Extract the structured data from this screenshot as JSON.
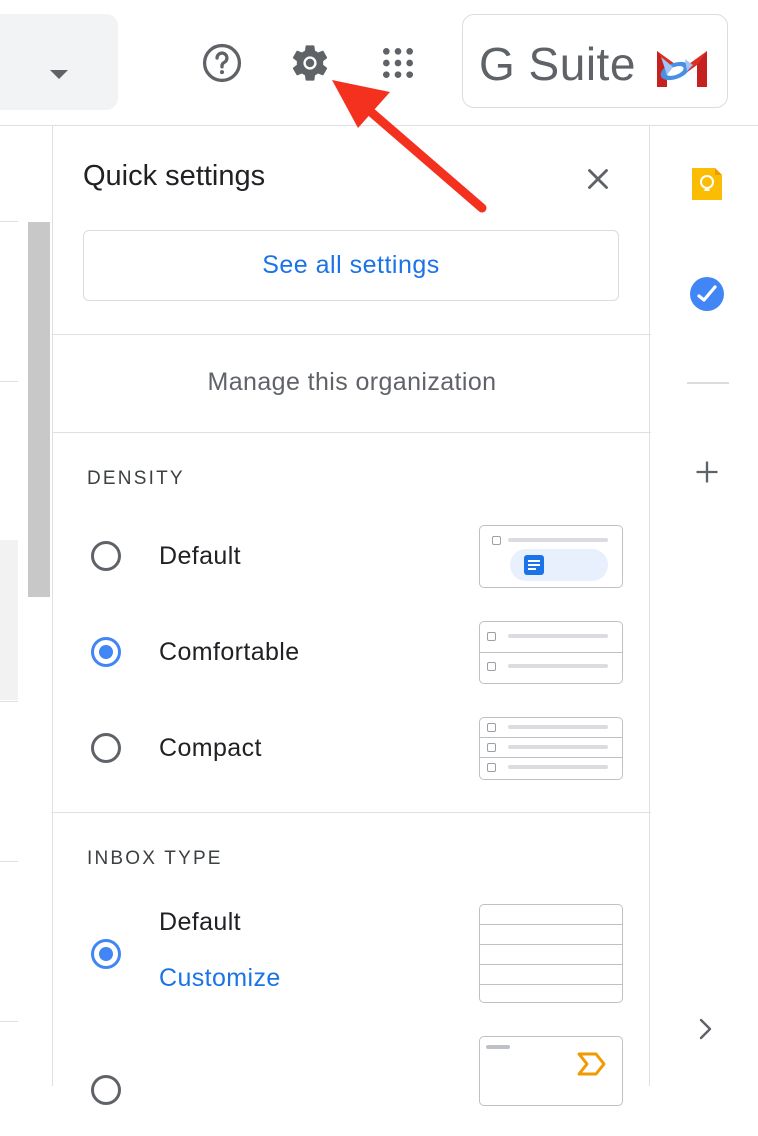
{
  "header": {
    "help_icon": "help-circle-icon",
    "settings_icon": "gear-icon",
    "apps_icon": "apps-grid-icon",
    "brand_text": "G Suite",
    "colors": {
      "icon": "#5f6368",
      "brand_text": "#5f6368"
    }
  },
  "quick_settings": {
    "title": "Quick settings",
    "see_all": "See all settings",
    "manage": "Manage this organization",
    "density": {
      "heading": "DENSITY",
      "options": [
        {
          "label": "Default",
          "selected": false
        },
        {
          "label": "Comfortable",
          "selected": true
        },
        {
          "label": "Compact",
          "selected": false
        }
      ]
    },
    "inbox_type": {
      "heading": "INBOX TYPE",
      "options": [
        {
          "label": "Default",
          "selected": true,
          "link": "Customize"
        }
      ]
    }
  },
  "colors": {
    "accent": "#1a73e8",
    "radio_selected": "#4285f4",
    "annotation_arrow": "#f4311f",
    "keep": "#fbbc04",
    "tasks": "#4285f4"
  }
}
